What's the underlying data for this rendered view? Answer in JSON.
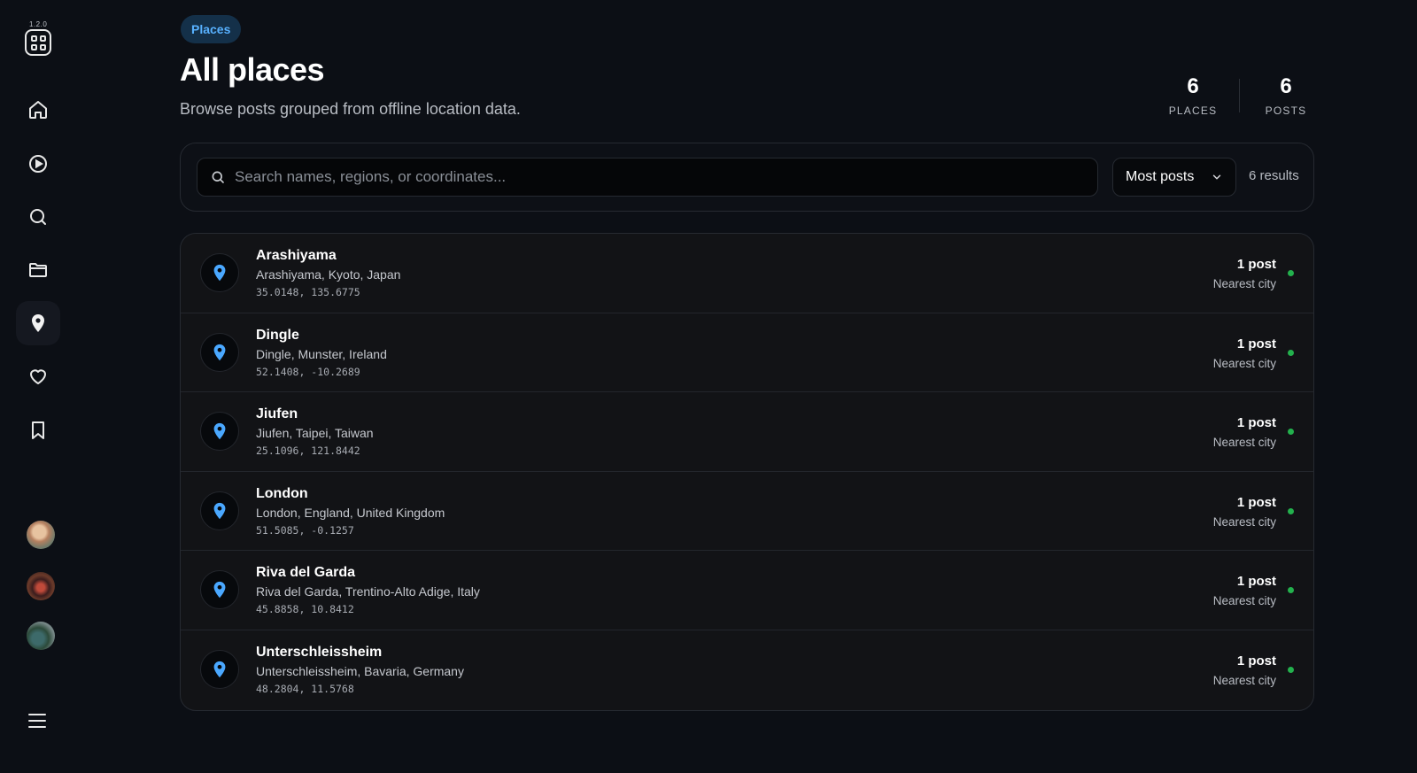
{
  "app": {
    "version": "1.2.0",
    "logo_icon": "grid-apps-icon"
  },
  "sidebar": {
    "nav": [
      {
        "id": "home",
        "icon": "home-icon"
      },
      {
        "id": "play",
        "icon": "play-circle-icon"
      },
      {
        "id": "search",
        "icon": "search-icon"
      },
      {
        "id": "folder",
        "icon": "folder-icon"
      },
      {
        "id": "places",
        "icon": "location-pin-icon",
        "active": true
      },
      {
        "id": "likes",
        "icon": "heart-icon"
      },
      {
        "id": "saved",
        "icon": "bookmark-icon"
      }
    ],
    "avatars": [
      "avatar-1",
      "avatar-2",
      "avatar-3"
    ],
    "menu_icon": "hamburger-menu-icon"
  },
  "header": {
    "pill": "Places",
    "title": "All places",
    "subtitle": "Browse posts grouped from offline location data.",
    "stats": [
      {
        "value": "6",
        "label": "PLACES"
      },
      {
        "value": "6",
        "label": "POSTS"
      }
    ]
  },
  "search": {
    "placeholder": "Search names, regions, or coordinates...",
    "value": "",
    "sort_label": "Most posts",
    "results": "6 results"
  },
  "places": [
    {
      "name": "Arashiyama",
      "region": "Arashiyama, Kyoto, Japan",
      "coords": "35.0148, 135.6775",
      "count": "1 post",
      "kind": "Nearest city"
    },
    {
      "name": "Dingle",
      "region": "Dingle, Munster, Ireland",
      "coords": "52.1408, -10.2689",
      "count": "1 post",
      "kind": "Nearest city"
    },
    {
      "name": "Jiufen",
      "region": "Jiufen, Taipei, Taiwan",
      "coords": "25.1096, 121.8442",
      "count": "1 post",
      "kind": "Nearest city"
    },
    {
      "name": "London",
      "region": "London, England, United Kingdom",
      "coords": "51.5085, -0.1257",
      "count": "1 post",
      "kind": "Nearest city"
    },
    {
      "name": "Riva del Garda",
      "region": "Riva del Garda, Trentino-Alto Adige, Italy",
      "coords": "45.8858, 10.8412",
      "count": "1 post",
      "kind": "Nearest city"
    },
    {
      "name": "Unterschleissheim",
      "region": "Unterschleissheim, Bavaria, Germany",
      "coords": "48.2804, 11.5768",
      "count": "1 post",
      "kind": "Nearest city"
    }
  ],
  "colors": {
    "background": "#0c0f15",
    "accent": "#58b1ff",
    "pin": "#4aa8ff",
    "status_dot": "#23b14d"
  }
}
